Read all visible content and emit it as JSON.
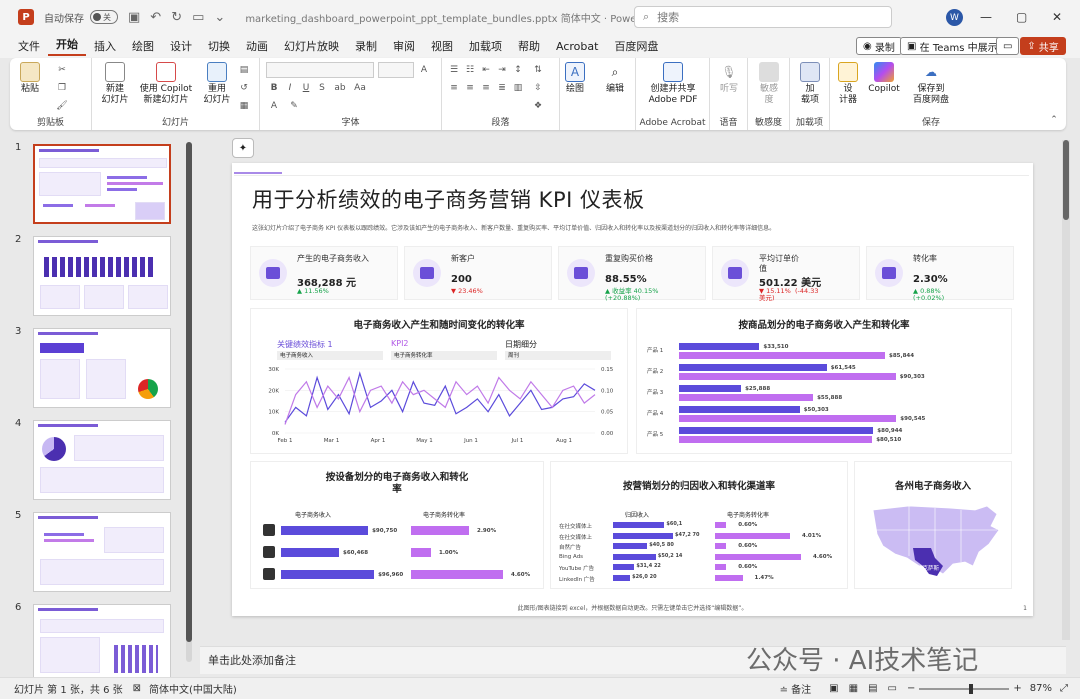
{
  "titlebar": {
    "autosave_label": "自动保存",
    "autosave_state": "关",
    "doc_title": "marketing_dashboard_powerpoint_ppt_template_bundles.pptx  简体中文  ·  PowerPo...",
    "search_placeholder": "搜索",
    "user_initial": "W"
  },
  "menu": {
    "tabs": [
      "文件",
      "开始",
      "插入",
      "绘图",
      "设计",
      "切换",
      "动画",
      "幻灯片放映",
      "录制",
      "审阅",
      "视图",
      "加载项",
      "帮助",
      "Acrobat",
      "百度网盘"
    ],
    "active": "开始",
    "record_label": "录制",
    "teams_label": "在 Teams 中展示",
    "share_label": "共享"
  },
  "ribbon": {
    "paste": "粘贴",
    "clipboard_group": "剪贴板",
    "new_slide": "新建\n幻灯片",
    "copilot_new": "使用 Copilot\n新建幻灯片",
    "reuse": "重用\n幻灯片",
    "slides_group": "幻灯片",
    "font_group": "字体",
    "paragraph_group": "段落",
    "drawing": "绘图",
    "editing": "编辑",
    "create_pdf": "创建并共享\nAdobe PDF",
    "acrobat_group": "Adobe Acrobat",
    "dictate": "听写",
    "voice_group": "语音",
    "sensitivity": "敏感\n度",
    "sensitivity_group": "敏感度",
    "addins": "加\n载项",
    "addins_group": "加载项",
    "designer": "设\n计器",
    "copilot": "Copilot",
    "save_baidu": "保存到\n百度网盘",
    "save_group": "保存"
  },
  "thumbnails": [
    "1",
    "2",
    "3",
    "4",
    "5",
    "6"
  ],
  "slide": {
    "title": "用于分析绩效的电子商务营销 KPI 仪表板",
    "subtitle": "这张幻灯片介绍了电子商务 KPI 仪表板以跟踪绩效。它涉及该如产生的电子商务收入、新客户数量、重复购买率、平均订单价值、归因收入和转化率以及按渠道划分的归因收入和转化率等详细信息。",
    "kpis": [
      {
        "name": "产生的电子商务收入",
        "value": "368,288 元",
        "change": "▲ 11.56%",
        "dir": "up"
      },
      {
        "name": "新客户",
        "value": "200",
        "change": "▼ 23.46%",
        "dir": "down"
      },
      {
        "name": "重复购买价格",
        "value": "88.55%",
        "change": "▲ 收益率 40.15%\n(+20.88%)",
        "dir": "up"
      },
      {
        "name": "平均订单价\n值",
        "value": "501.22 美元",
        "change": "▼ 15.11%  (-44.33\n美元)",
        "dir": "down"
      },
      {
        "name": "转化率",
        "value": "2.30%",
        "change": "▲ 0.88%\n(+0.02%)",
        "dir": "up"
      }
    ],
    "line_panel": {
      "title": "电子商务收入产生和随时间变化的转化率",
      "kpi1_label": "关键绩效指标 1",
      "kpi1_sub": "电子商务收入",
      "kpi2_label": "KPI2",
      "kpi2_sub": "电子商务转化率",
      "period_label": "日期细分",
      "period_sub": "周刊"
    },
    "product_panel": {
      "title": "按商品划分的电子商务收入产生和转化率"
    },
    "device_panel": {
      "title": "按设备划分的电子商务收入和转化\n率",
      "col1": "电子商务收入",
      "col2": "电子商务转化率"
    },
    "channel_panel": {
      "title": "按营销划分的归因收入和转化渠道率",
      "col1": "归因收入",
      "col2": "电子商务转化率"
    },
    "map_panel": {
      "title": "各州电子商务收入",
      "highlight_label": "德克萨斯"
    },
    "footer_note": "此图形/图表链接到 excel，并根据数据自动更改。只需左键单击它并选择“编辑数据”。",
    "page_number": "1"
  },
  "chart_data": [
    {
      "type": "line",
      "title": "电子商务收入产生和随时间变化的转化率",
      "x_ticks": [
        "Feb 1",
        "Mar 1",
        "Apr 1",
        "May 1",
        "Jun 1",
        "Jul 1",
        "Aug 1"
      ],
      "y_ticks_left": [
        "0K",
        "10K",
        "20K",
        "30K"
      ],
      "y_ticks_right": [
        "0.00",
        "0.05",
        "0.10",
        "0.15"
      ],
      "ylim_left": [
        0,
        30000
      ],
      "ylim_right": [
        0,
        0.15
      ],
      "series": [
        {
          "name": "KPI1",
          "color": "#5b4bdb",
          "axis": "left",
          "values": [
            5000,
            12000,
            8000,
            26000,
            11000,
            18000,
            9000,
            28000,
            12000,
            15000,
            20000,
            10000,
            24000,
            14000,
            13000,
            22000,
            9000,
            12000,
            16000,
            10000,
            18000,
            8000,
            14000,
            20000,
            11000,
            12000,
            16000,
            17000,
            23000,
            20000
          ]
        },
        {
          "name": "KPI2",
          "color": "#c07ae8",
          "axis": "right",
          "values": [
            0.02,
            0.09,
            0.12,
            0.06,
            0.11,
            0.08,
            0.13,
            0.05,
            0.1,
            0.11,
            0.07,
            0.12,
            0.09,
            0.1,
            0.08,
            0.06,
            0.12,
            0.09,
            0.11,
            0.07,
            0.13,
            0.1,
            0.08,
            0.12,
            0.09,
            0.06,
            0.1,
            0.11,
            0.07,
            0.09
          ]
        }
      ]
    },
    {
      "type": "bar",
      "title": "按商品划分的电子商务收入产生和转化率",
      "categories": [
        "产品 1",
        "产品 2",
        "产品 3",
        "产品 4",
        "产品 5"
      ],
      "series": [
        {
          "name": "收入",
          "color": "#5b4bdb",
          "values": [
            33510,
            61545,
            25888,
            50303,
            80944
          ],
          "labels": [
            "$33,510",
            "$61,545",
            "$25,888",
            "$50,303",
            "$80,944"
          ]
        },
        {
          "name": "转化率",
          "color": "#c06ef0",
          "values": [
            85844,
            90303,
            55888,
            90545,
            80510
          ],
          "labels": [
            "$85,844",
            "$90,303",
            "$55,888",
            "$90,545",
            "$80,510"
          ]
        }
      ]
    },
    {
      "type": "bar",
      "title": "按设备划分的电子商务收入和转化率",
      "categories": [
        "移动设备",
        "台式电脑",
        "平板电脑"
      ],
      "series": [
        {
          "name": "电子商务收入",
          "color": "#5b4bdb",
          "values": [
            90750,
            60468,
            96960
          ],
          "labels": [
            "$90,750",
            "$60,468",
            "$96,960"
          ]
        },
        {
          "name": "电子商务转化率",
          "color": "#c06ef0",
          "values": [
            2.9,
            1.0,
            4.6
          ],
          "labels": [
            "2.90%",
            "1.00%",
            "4.60%"
          ]
        }
      ]
    },
    {
      "type": "bar",
      "title": "按营销划分的归因收入和转化渠道率",
      "categories": [
        "在社交媒体上",
        "在社交媒体上",
        "自然广告",
        "Bing Ads",
        "YouTube 广告",
        "LinkedIn 广告"
      ],
      "series": [
        {
          "name": "归因收入",
          "color": "#5b4bdb",
          "values": [
            60,
            70,
            40,
            50,
            25,
            20
          ],
          "labels": [
            "$60,1",
            "$47,2 70",
            "$40,5 80",
            "$50,2 14",
            "$31,4 22",
            "$26,0 20"
          ]
        },
        {
          "name": "电子商务转化率",
          "color": "#c06ef0",
          "values": [
            0.6,
            4.01,
            0.6,
            4.6,
            0.6,
            1.47
          ],
          "labels": [
            "0.60%",
            "4.01%",
            "0.60%",
            "4.60%",
            "0.60%",
            "1.47%"
          ]
        }
      ]
    }
  ],
  "notes_placeholder": "单击此处添加备注",
  "status": {
    "slide_count": "幻灯片 第 1 张，共 6 张",
    "language": "简体中文(中国大陆)",
    "notes_label": "备注",
    "zoom": "87%"
  },
  "watermark": "公众号 · AI技术笔记"
}
